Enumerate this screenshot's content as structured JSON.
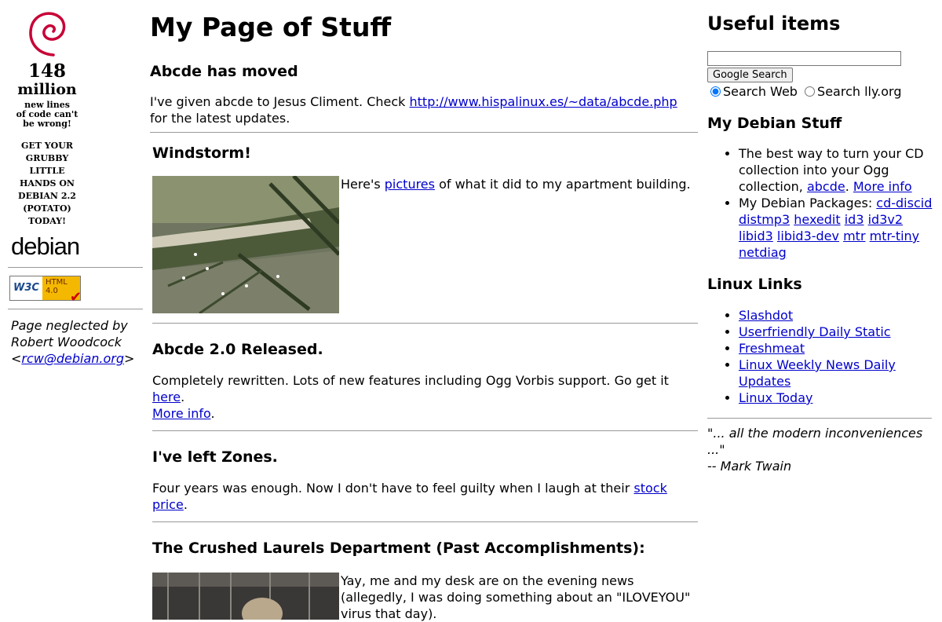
{
  "left": {
    "promo_big": "148",
    "promo_mid": "million",
    "promo_small": [
      "new lines",
      "of code can't",
      "be wrong!"
    ],
    "promo_caps": [
      "GET YOUR",
      "GRUBBY",
      "LITTLE",
      "HANDS ON",
      "DEBIAN 2.2",
      "(POTATO)",
      "TODAY!"
    ],
    "wordmark": "debian",
    "badge_w3c": "W3C",
    "badge_html": "HTML",
    "badge_version": "4.0",
    "neglect_line1": "Page neglected by",
    "neglect_line2": "Robert Woodcock",
    "email_open": "<",
    "email": "rcw@debian.org",
    "email_close": ">"
  },
  "main": {
    "title": "My Page of Stuff",
    "s1": {
      "heading": "Abcde has moved",
      "t1": "I've given abcde to Jesus Climent. Check ",
      "link": "http://www.hispalinux.es/~data/abcde.php",
      "t2": " for the latest updates."
    },
    "s2": {
      "heading": "Windstorm!",
      "t1": "Here's ",
      "link": "pictures",
      "t2": " of what it did to my apartment building."
    },
    "s3": {
      "heading": "Abcde 2.0 Released.",
      "t1": "Completely rewritten. Lots of new features including Ogg Vorbis support. Go get it ",
      "link1": "here",
      "t2": ".",
      "link2": "More info",
      "t3": "."
    },
    "s4": {
      "heading": "I've left Zones.",
      "t1": "Four years was enough. Now I don't have to feel guilty when I laugh at their ",
      "link": "stock price",
      "t2": "."
    },
    "s5": {
      "heading": "The Crushed Laurels Department (Past Accomplishments):",
      "t1": "Yay, me and my desk are on the evening news (allegedly, I was doing something about an \"ILOVEYOU\" virus that day)."
    }
  },
  "right": {
    "useful_heading": "Useful items",
    "search_value": "",
    "search_button": "Google Search",
    "radio_web": "Search Web",
    "radio_site": "Search lly.org",
    "debian_heading": "My Debian Stuff",
    "d1_t1": "The best way to turn your CD collection into your Ogg collection, ",
    "d1_link1": "abcde",
    "d1_t2": ". ",
    "d1_link2": "More info",
    "d2_t1": "My Debian Packages: ",
    "packages": [
      "cd-discid",
      "distmp3",
      "hexedit",
      "id3",
      "id3v2",
      "libid3",
      "libid3-dev",
      "mtr",
      "mtr-tiny",
      "netdiag"
    ],
    "linux_heading": "Linux Links",
    "links": [
      "Slashdot",
      "Userfriendly Daily Static",
      "Freshmeat",
      "Linux Weekly News Daily Updates",
      "Linux Today"
    ],
    "quote1": "\"... all the modern inconveniences ...\"",
    "quote2": "-- Mark Twain"
  },
  "colors": {
    "link": "#0000cc",
    "swirl": "#c70036",
    "rule": "#999999"
  }
}
